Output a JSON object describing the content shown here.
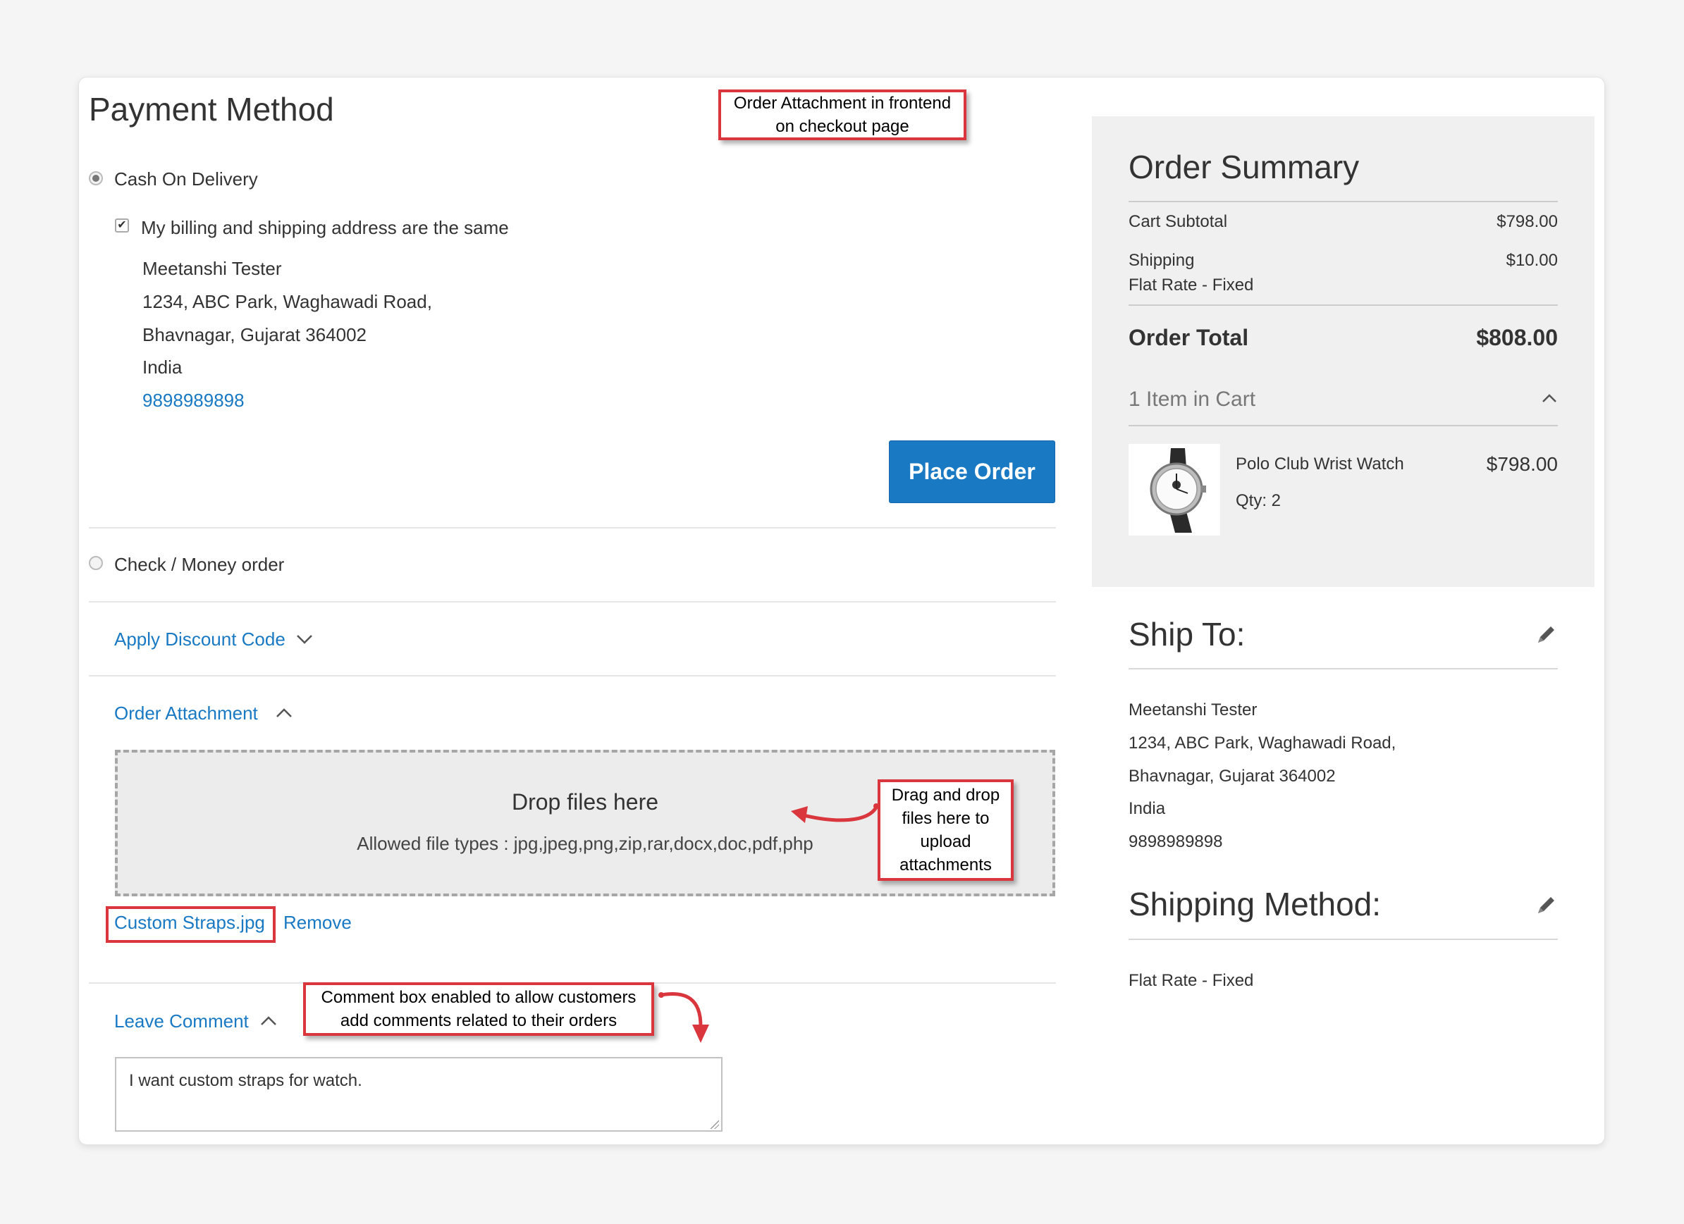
{
  "payment": {
    "title": "Payment Method",
    "methods": [
      {
        "label": "Cash On Delivery",
        "selected": true
      },
      {
        "label": "Check / Money order",
        "selected": false
      }
    ],
    "same_address_label": "My billing and shipping address are the same",
    "same_address_checked": true,
    "address": {
      "name": "Meetanshi Tester",
      "street": "1234, ABC Park, Waghawadi Road,",
      "city": "Bhavnagar, Gujarat 364002",
      "country": "India",
      "phone": "9898989898"
    },
    "place_order": "Place Order"
  },
  "discount": {
    "label": "Apply Discount Code"
  },
  "attachment": {
    "label": "Order Attachment",
    "drop_title": "Drop files here",
    "allowed_types": "Allowed file types : jpg,jpeg,png,zip,rar,docx,doc,pdf,php",
    "file_name": "Custom Straps.jpg",
    "remove": "Remove"
  },
  "comment": {
    "label": "Leave Comment",
    "value": "I want custom straps for watch."
  },
  "annotations": {
    "top": [
      "Order Attachment in frontend",
      "on checkout page"
    ],
    "drag": [
      "Drag and drop",
      "files here to",
      "upload",
      "attachments"
    ],
    "comment": [
      "Comment box enabled to allow customers",
      "add comments related to their orders"
    ]
  },
  "summary": {
    "title": "Order Summary",
    "subtotal_label": "Cart Subtotal",
    "subtotal_value": "$798.00",
    "shipping_label": "Shipping",
    "shipping_method": "Flat Rate - Fixed",
    "shipping_value": "$10.00",
    "total_label": "Order Total",
    "total_value": "$808.00",
    "items_label": "1 Item in Cart",
    "item": {
      "name": "Polo Club Wrist Watch",
      "qty": "Qty: 2",
      "price": "$798.00"
    }
  },
  "ship_to": {
    "title": "Ship To:",
    "name": "Meetanshi Tester",
    "street": "1234, ABC Park, Waghawadi Road,",
    "city": "Bhavnagar, Gujarat 364002",
    "country": "India",
    "phone": "9898989898"
  },
  "shipping_method": {
    "title": "Shipping Method:",
    "value": "Flat Rate - Fixed"
  },
  "colors": {
    "accent": "#1979c3",
    "annotation_red": "#d9363e",
    "panel_grey": "#f0f0f0"
  },
  "icons": [
    "radio-selected-icon",
    "radio-icon",
    "checkbox-icon",
    "chevron-down-icon",
    "chevron-up-icon",
    "pencil-icon",
    "curved-arrow-icon"
  ]
}
